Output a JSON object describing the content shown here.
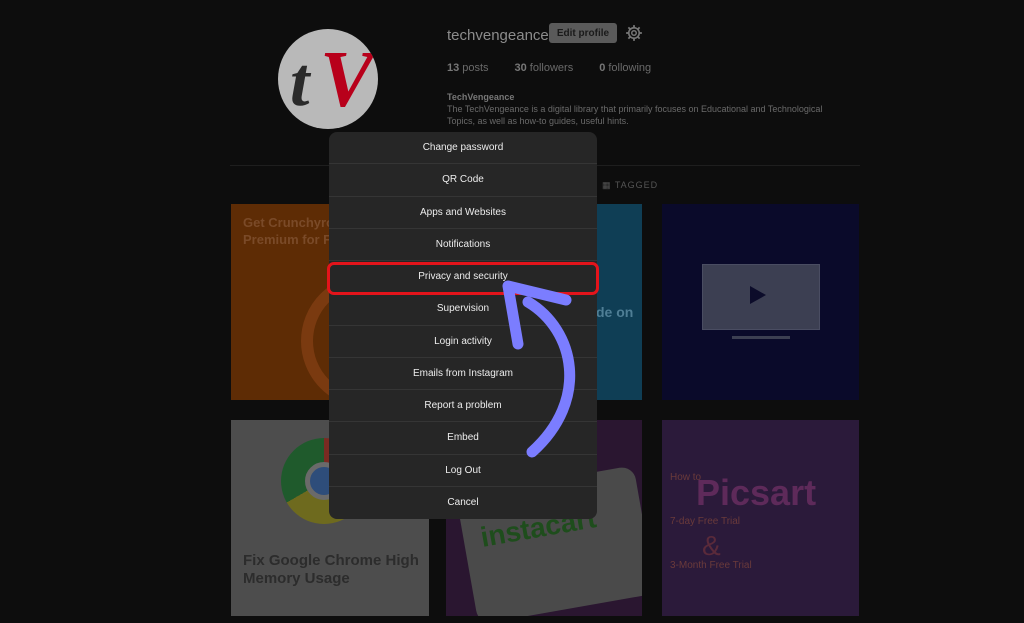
{
  "profile": {
    "username": "techvengeance",
    "edit_profile_label": "Edit profile",
    "stats": {
      "posts_count": "13",
      "posts_label": "posts",
      "followers_count": "30",
      "followers_label": "followers",
      "following_count": "0",
      "following_label": "following"
    },
    "bio_name": "TechVengeance",
    "bio_text": "The TechVengeance is a digital library that primarily focuses on Educational and Technological Topics, as well as how-to guides, useful hints.",
    "logo_letters": [
      "t",
      "V"
    ]
  },
  "tabs": {
    "tagged_label": "TAGGED"
  },
  "posts": [
    {
      "headline_a": "Get ",
      "headline_b": "Crunchyroll",
      "headline_c": "Premium for Fre"
    },
    {
      "text": "de on"
    },
    {
      "kind": "video"
    },
    {
      "caption_a": "Fix ",
      "caption_b": "Google Chrome",
      "caption_c": " High Memory Usage"
    },
    {
      "brand": "instacart"
    },
    {
      "brand": "Picsart",
      "line1": "How to",
      "line2": "7-day Free Trial",
      "amp": "&",
      "line3": "3-Month Free Trial"
    }
  ],
  "menu": {
    "items": [
      "Change password",
      "QR Code",
      "Apps and Websites",
      "Notifications",
      "Privacy and security",
      "Supervision",
      "Login activity",
      "Emails from Instagram",
      "Report a problem",
      "Embed",
      "Log Out",
      "Cancel"
    ],
    "highlighted_index": 4
  },
  "colors": {
    "highlight": "#e3141b",
    "arrow": "#7b7dff",
    "modal_bg": "#262626"
  }
}
